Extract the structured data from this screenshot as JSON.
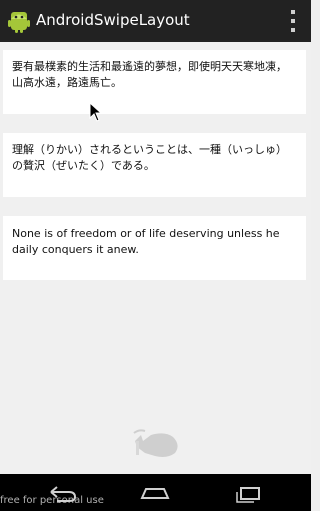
{
  "app": {
    "title": "AndroidSwipeLayout",
    "icon": "android-robot-icon",
    "menu_icon": "overflow-menu-icon"
  },
  "cards": [
    {
      "text": "要有最樸素的生活和最遙遠的夢想，即使明天天寒地凍，山高水遠，路遠馬亡。"
    },
    {
      "text": "理解（りかい）されるということは、一種（いっしゅ）の贅沢（ぜいたく）である。"
    },
    {
      "text": "None is of freedom or of life deserving unless he daily conquers it anew."
    }
  ],
  "nav": {
    "back_icon": "back-arrow-icon",
    "home_icon": "home-icon",
    "recent_icon": "recent-apps-icon"
  },
  "watermark": "free for personal use",
  "colors": {
    "action_bar": "#222222",
    "background": "#efefef",
    "card": "#ffffff",
    "nav_bar": "#000000",
    "android_green": "#a4c639"
  }
}
